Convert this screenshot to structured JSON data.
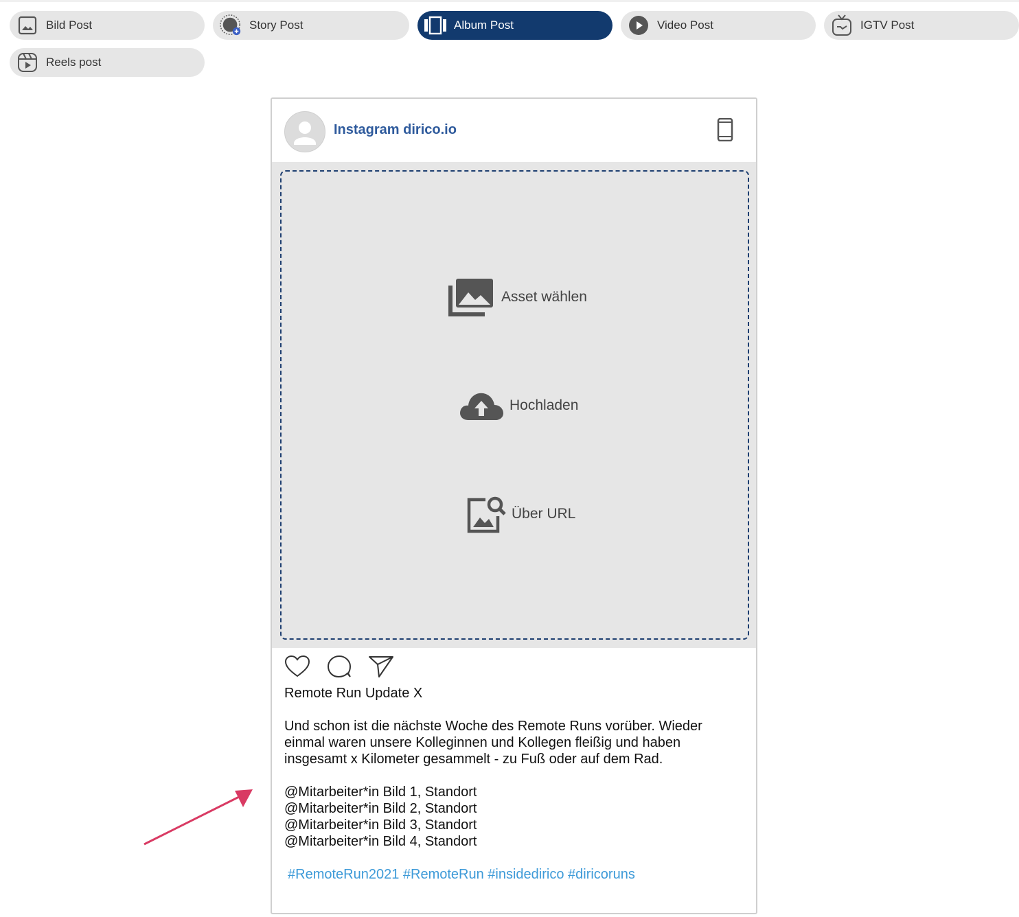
{
  "tabs": [
    {
      "label": "Bild Post",
      "icon": "image-icon",
      "active": false
    },
    {
      "label": "Story Post",
      "icon": "story-icon",
      "active": false
    },
    {
      "label": "Album Post",
      "icon": "album-icon",
      "active": true
    },
    {
      "label": "Video Post",
      "icon": "play-icon",
      "active": false
    },
    {
      "label": "IGTV Post",
      "icon": "igtv-icon",
      "active": false
    },
    {
      "label": "Reels post",
      "icon": "reels-icon",
      "active": false
    }
  ],
  "preview": {
    "account_name": "Instagram dirico.io",
    "avatar_icon": "person-icon",
    "device_icon": "smartphone-icon",
    "media_options": [
      {
        "label": "Asset wählen",
        "icon": "photo-library-icon"
      },
      {
        "label": "Hochladen",
        "icon": "cloud-upload-icon"
      },
      {
        "label": "Über URL",
        "icon": "image-search-icon"
      }
    ],
    "action_icons": [
      "heart-icon",
      "comment-icon",
      "share-icon"
    ],
    "caption": {
      "title": "Remote Run Update X",
      "body": [
        "Und schon ist die nächste Woche des Remote Runs vorüber. Wieder",
        "einmal waren unsere Kolleginnen und Kollegen fleißig und haben",
        "insgesamt x Kilometer gesammelt - zu Fuß oder auf dem Rad."
      ],
      "mentions": [
        "@Mitarbeiter*in Bild 1, Standort",
        "@Mitarbeiter*in Bild 2, Standort",
        "@Mitarbeiter*in Bild 3, Standort",
        "@Mitarbeiter*in Bild 4, Standort"
      ],
      "hashtags": "#RemoteRun2021 #RemoteRun #insidedirico #diricoruns"
    }
  },
  "colors": {
    "active_tab": "#123a6e",
    "account_name": "#2e5a9c",
    "hashtag": "#3d9ad8",
    "arrow": "#d93a63"
  }
}
